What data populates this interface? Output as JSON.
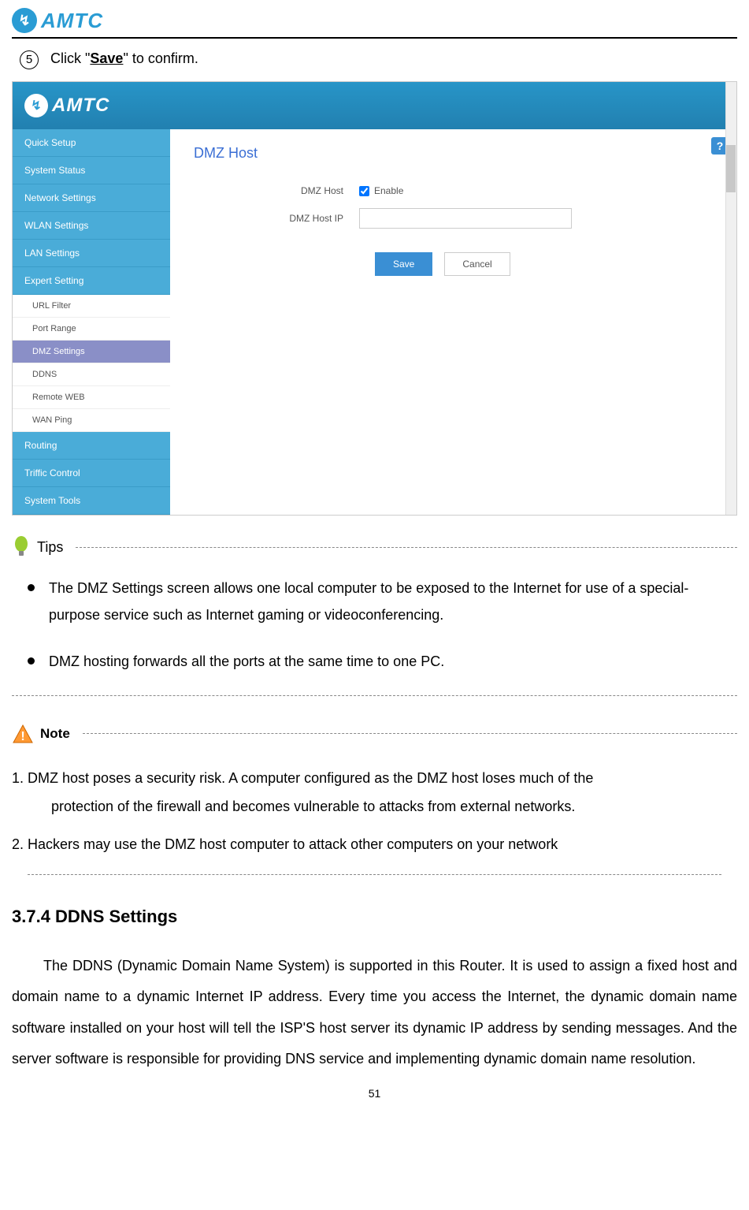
{
  "header": {
    "logo_symbol": "↯",
    "logo_text": "AMTC"
  },
  "instruction": {
    "step_num": "5",
    "prefix": "Click \"",
    "save": "Save",
    "suffix": "\" to confirm."
  },
  "screenshot": {
    "logo_symbol": "↯",
    "logo_text": "AMTC",
    "help": "?",
    "sidebar": {
      "quick_setup": "Quick Setup",
      "system_status": "System Status",
      "network_settings": "Network Settings",
      "wlan_settings": "WLAN Settings",
      "lan_settings": "LAN Settings",
      "expert_setting": "Expert Setting",
      "url_filter": "URL Filter",
      "port_range": "Port Range",
      "dmz_settings": "DMZ Settings",
      "ddns": "DDNS",
      "remote_web": "Remote WEB",
      "wan_ping": "WAN Ping",
      "routing": "Routing",
      "triffic_control": "Triffic Control",
      "system_tools": "System Tools"
    },
    "content": {
      "title": "DMZ Host",
      "label_host": "DMZ Host",
      "enable": "Enable",
      "label_ip": "DMZ Host IP",
      "ip_value": "",
      "save": "Save",
      "cancel": "Cancel"
    }
  },
  "tips": {
    "label": "Tips",
    "items": [
      "The DMZ Settings screen allows one local computer to be exposed to the Internet for use of a special-purpose service such as Internet gaming or videoconferencing.",
      "DMZ hosting forwards all the ports at the same time to one PC."
    ]
  },
  "note": {
    "label": "Note",
    "items": [
      {
        "num": "1.",
        "text_line1": "DMZ host poses a security risk. A computer configured as the DMZ host loses much of the",
        "text_line2": "protection of the firewall and becomes vulnerable to attacks from external networks."
      },
      {
        "num": "2.",
        "text": "Hackers may use the DMZ host computer to attack other computers on your network"
      }
    ]
  },
  "section": {
    "heading": "3.7.4 DDNS Settings",
    "paragraph": "The DDNS (Dynamic Domain Name System) is supported in this Router. It is used to assign a fixed host and domain name to a dynamic Internet IP address. Every time you access the Internet, the dynamic domain name software installed on your host will tell the ISP'S host server its dynamic IP address by sending messages. And the server software is responsible for providing DNS service and implementing dynamic domain name resolution."
  },
  "page_number": "51"
}
